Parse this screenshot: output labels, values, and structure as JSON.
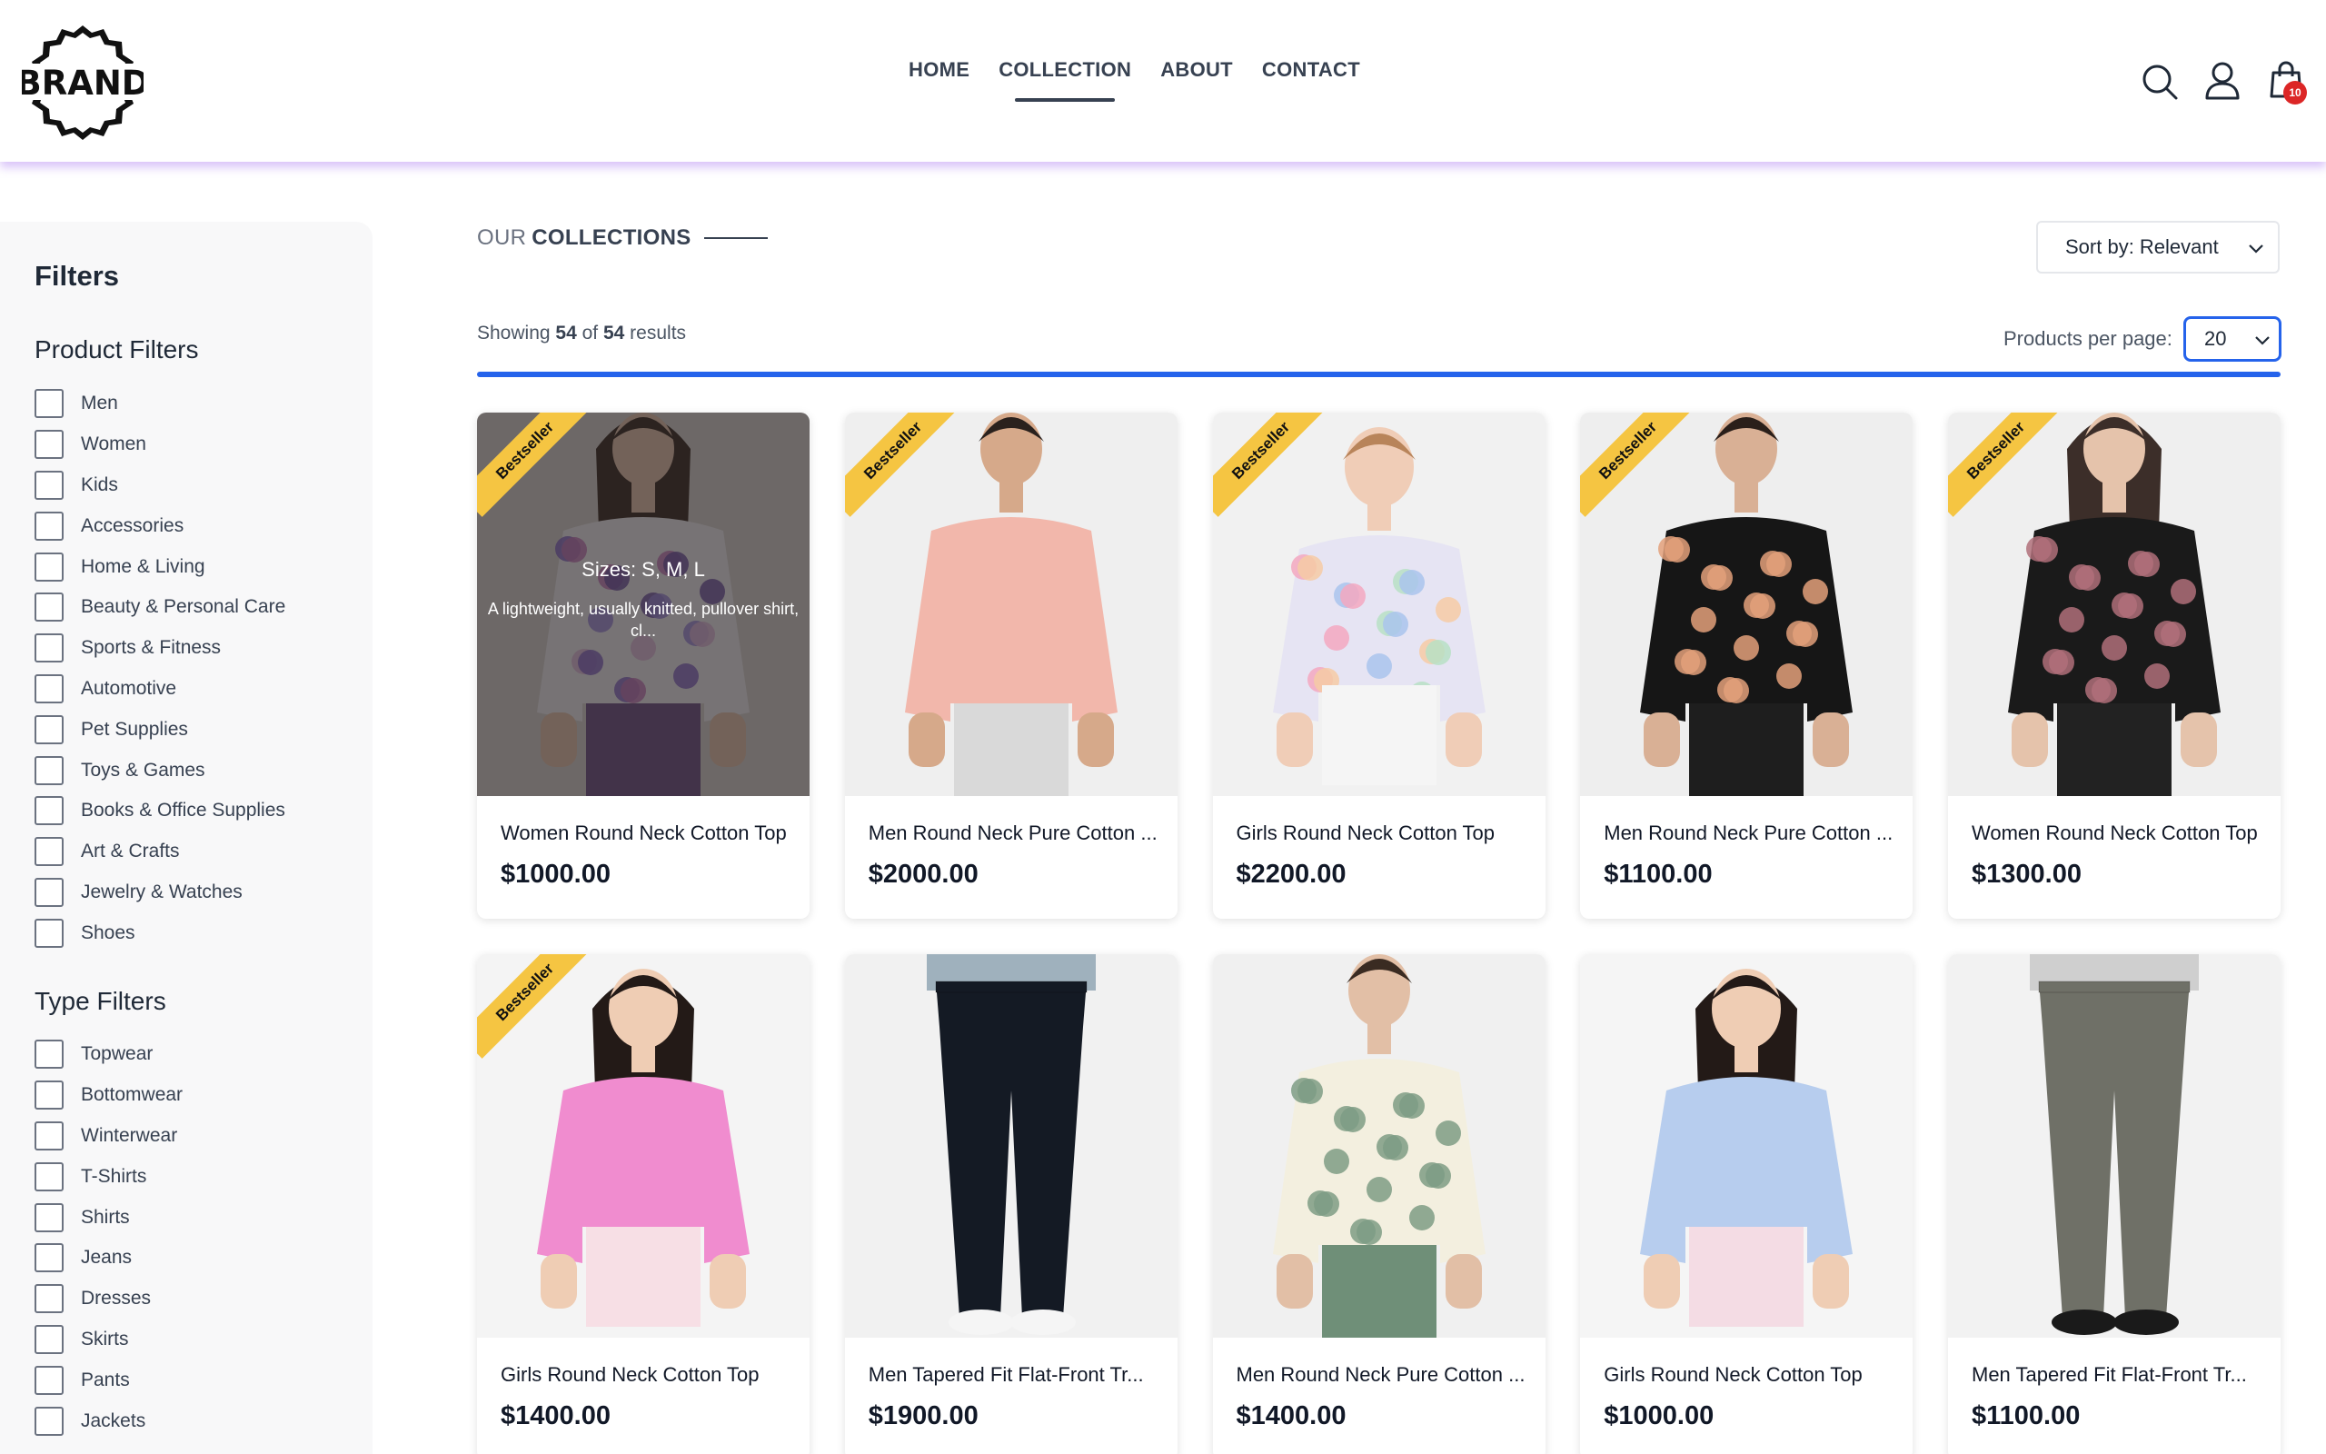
{
  "brand": {
    "logo_text": "BRAND"
  },
  "nav": {
    "items": [
      {
        "label": "HOME",
        "active": false
      },
      {
        "label": "COLLECTION",
        "active": true
      },
      {
        "label": "ABOUT",
        "active": false
      },
      {
        "label": "CONTACT",
        "active": false
      }
    ]
  },
  "header_icons": {
    "search": "search-icon",
    "profile": "user-icon",
    "cart": "shopping-bag-icon",
    "cart_count": "10"
  },
  "sidebar": {
    "title": "Filters",
    "product_filters": {
      "title": "Product Filters",
      "items": [
        "Men",
        "Women",
        "Kids",
        "Accessories",
        "Home & Living",
        "Beauty & Personal Care",
        "Sports & Fitness",
        "Automotive",
        "Pet Supplies",
        "Toys & Games",
        "Books & Office Supplies",
        "Art & Crafts",
        "Jewelry & Watches",
        "Shoes"
      ]
    },
    "type_filters": {
      "title": "Type Filters",
      "items": [
        "Topwear",
        "Bottomwear",
        "Winterwear",
        "T-Shirts",
        "Shirts",
        "Jeans",
        "Dresses",
        "Skirts",
        "Pants",
        "Jackets"
      ]
    }
  },
  "main": {
    "title_light": "OUR",
    "title_strong": "COLLECTIONS",
    "sort_label": "Sort by: Relevant",
    "showing": {
      "prefix": "Showing",
      "count": "54",
      "of": "of",
      "total": "54",
      "suffix": "results"
    },
    "per_page_label": "Products per page:",
    "per_page_value": "20"
  },
  "products": [
    {
      "name": "Women Round Neck Cotton Top",
      "price": "$1000.00",
      "bestseller": true,
      "badge": "Bestseller",
      "hover": true,
      "sizes": "Sizes: S, M, L",
      "desc": "A lightweight, usually knitted, pullover shirt, cl...",
      "img": "woman-floral"
    },
    {
      "name": "Men Round Neck Pure Cotton ...",
      "price": "$2000.00",
      "bestseller": true,
      "badge": "Bestseller",
      "img": "man-pink"
    },
    {
      "name": "Girls Round Neck Cotton Top",
      "price": "$2200.00",
      "bestseller": true,
      "badge": "Bestseller",
      "img": "girl-dress"
    },
    {
      "name": "Men Round Neck Pure Cotton ...",
      "price": "$1100.00",
      "bestseller": true,
      "badge": "Bestseller",
      "img": "man-black"
    },
    {
      "name": "Women Round Neck Cotton Top",
      "price": "$1300.00",
      "bestseller": true,
      "badge": "Bestseller",
      "img": "woman-black"
    },
    {
      "name": "Girls Round Neck Cotton Top",
      "price": "$1400.00",
      "bestseller": true,
      "badge": "Bestseller",
      "img": "girl-pink"
    },
    {
      "name": "Men Tapered Fit Flat-Front Tr...",
      "price": "$1900.00",
      "bestseller": false,
      "img": "man-jeans"
    },
    {
      "name": "Men Round Neck Pure Cotton ...",
      "price": "$1400.00",
      "bestseller": false,
      "img": "man-sweater"
    },
    {
      "name": "Girls Round Neck Cotton Top",
      "price": "$1000.00",
      "bestseller": false,
      "img": "girl-blue"
    },
    {
      "name": "Men Tapered Fit Flat-Front Tr...",
      "price": "$1100.00",
      "bestseller": false,
      "img": "man-cargo"
    }
  ],
  "colors": {
    "accent": "#2563eb",
    "badge": "#f5c542",
    "cart_badge": "#dc2626",
    "header_shadow": "#a878f0"
  }
}
